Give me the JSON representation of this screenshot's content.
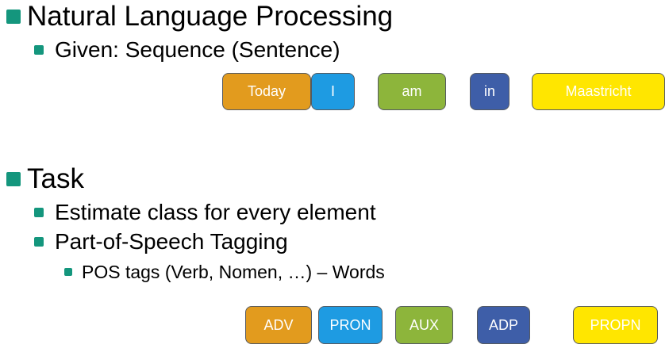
{
  "sections": {
    "nlp": {
      "heading": "Natural Language Processing",
      "sub": "Given: Sequence (Sentence)"
    },
    "task": {
      "heading": "Task",
      "items": [
        "Estimate class for every element",
        "Part-of-Speech Tagging"
      ],
      "subitem": "POS tags (Verb, Nomen, …) – Words"
    }
  },
  "words": [
    {
      "text": "Today",
      "color": "#e29b1e"
    },
    {
      "text": "I",
      "color": "#1e9be2"
    },
    {
      "text": "am",
      "color": "#8db53b"
    },
    {
      "text": "in",
      "color": "#3e5ea8"
    },
    {
      "text": "Maastricht",
      "color": "#ffe600"
    }
  ],
  "tags": [
    {
      "text": "ADV",
      "color": "#e29b1e"
    },
    {
      "text": "PRON",
      "color": "#1e9be2"
    },
    {
      "text": "AUX",
      "color": "#8db53b"
    },
    {
      "text": "ADP",
      "color": "#3e5ea8"
    },
    {
      "text": "PROPN",
      "color": "#ffe600"
    }
  ]
}
